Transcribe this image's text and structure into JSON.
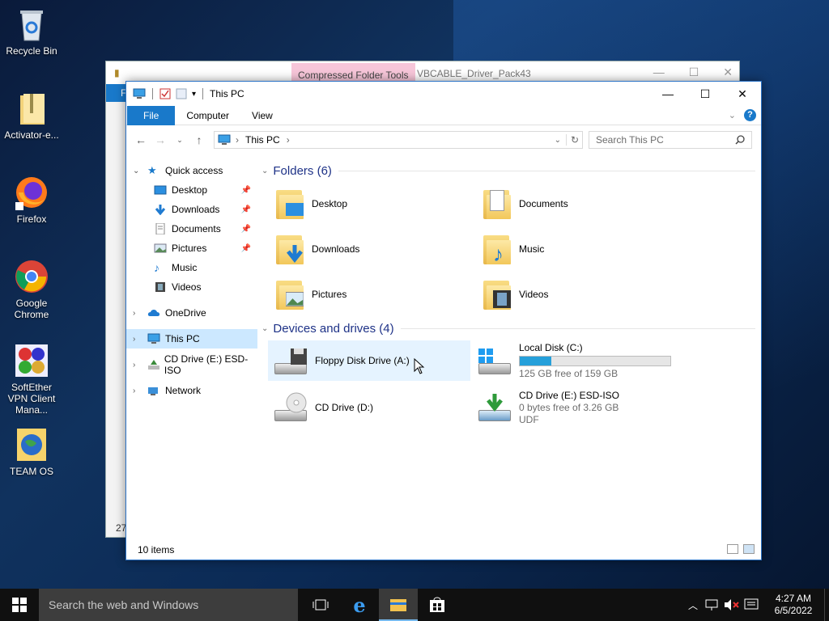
{
  "desktop": {
    "icons": [
      {
        "label": "Recycle Bin"
      },
      {
        "label": "Activator-e..."
      },
      {
        "label": "Firefox"
      },
      {
        "label": "Google Chrome"
      },
      {
        "label": "SoftEther VPN Client Mana..."
      },
      {
        "label": "TEAM OS"
      }
    ]
  },
  "back_window": {
    "context_tab": "Compressed Folder Tools",
    "title": "VBCABLE_Driver_Pack43",
    "partial_left_text": "F",
    "partial_bottom_text": "27"
  },
  "window": {
    "title": "This PC",
    "ribbon_tabs": [
      "File",
      "Computer",
      "View"
    ],
    "address": "This PC",
    "search_placeholder": "Search This PC",
    "status_items": "10 items"
  },
  "sidebar": {
    "quick_access": "Quick access",
    "quick_items": [
      "Desktop",
      "Downloads",
      "Documents",
      "Pictures",
      "Music",
      "Videos"
    ],
    "onedrive": "OneDrive",
    "this_pc": "This PC",
    "cd_drive": "CD Drive (E:) ESD-ISO",
    "network": "Network"
  },
  "content": {
    "folders_header": "Folders (6)",
    "folders": [
      "Desktop",
      "Documents",
      "Downloads",
      "Music",
      "Pictures",
      "Videos"
    ],
    "devices_header": "Devices and drives (4)",
    "drives": {
      "floppy": {
        "name": "Floppy Disk Drive (A:)"
      },
      "local": {
        "name": "Local Disk (C:)",
        "free": "125 GB free of 159 GB",
        "used_fraction": 0.21
      },
      "cd_d": {
        "name": "CD Drive (D:)"
      },
      "cd_e": {
        "name": "CD Drive (E:) ESD-ISO",
        "free": "0 bytes free of 3.26 GB",
        "fs": "UDF"
      }
    }
  },
  "taskbar": {
    "search": "Search the web and Windows",
    "time": "4:27 AM",
    "date": "6/5/2022"
  }
}
